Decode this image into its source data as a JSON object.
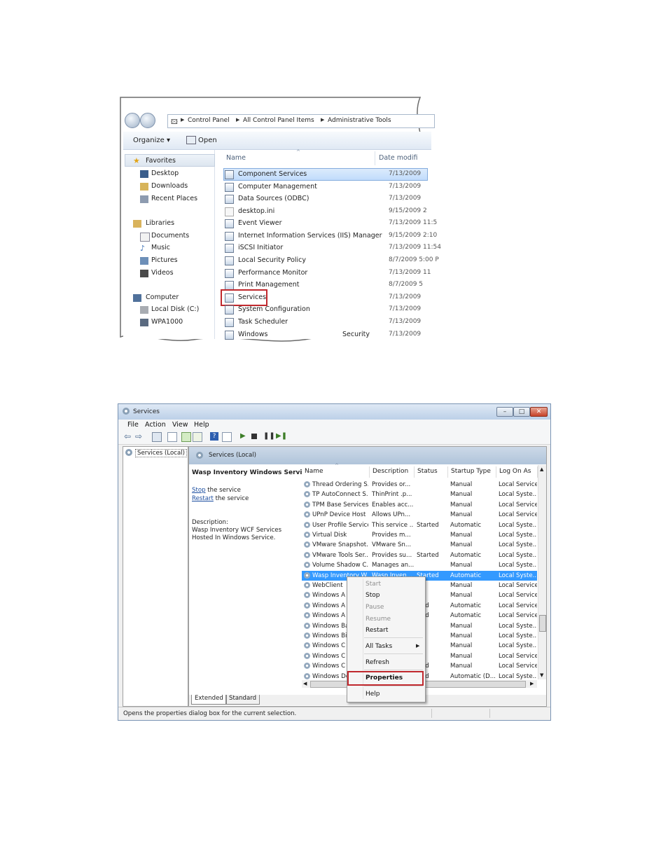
{
  "explorer": {
    "breadcrumb": [
      "Control Panel",
      "All Control Panel Items",
      "Administrative Tools"
    ],
    "toolbar": {
      "organize": "Organize",
      "open": "Open"
    },
    "nav": {
      "favorites": {
        "label": "Favorites",
        "items": [
          "Desktop",
          "Downloads",
          "Recent Places"
        ]
      },
      "libraries": {
        "label": "Libraries",
        "items": [
          "Documents",
          "Music",
          "Pictures",
          "Videos"
        ]
      },
      "computer": {
        "label": "Computer",
        "items": [
          "Local Disk (C:)",
          "WPA1000"
        ]
      }
    },
    "columns": {
      "name": "Name",
      "date": "Date modifi"
    },
    "files": [
      {
        "name": "Component Services",
        "date": "7/13/2009"
      },
      {
        "name": "Computer Management",
        "date": "7/13/2009"
      },
      {
        "name": "Data Sources (ODBC)",
        "date": "7/13/2009"
      },
      {
        "name": "desktop.ini",
        "date": "9/15/2009 2"
      },
      {
        "name": "Event Viewer",
        "date": "7/13/2009 11:5"
      },
      {
        "name": "Internet Information Services (IIS) Manager",
        "date": "9/15/2009 2:10"
      },
      {
        "name": "iSCSI Initiator",
        "date": "7/13/2009 11:54"
      },
      {
        "name": "Local Security Policy",
        "date": "8/7/2009 5:00 P"
      },
      {
        "name": "Performance Monitor",
        "date": "7/13/2009 11"
      },
      {
        "name": "Print Management",
        "date": "8/7/2009 5"
      },
      {
        "name": "Services",
        "date": "7/13/2009"
      },
      {
        "name": "System Configuration",
        "date": "7/13/2009"
      },
      {
        "name": "Task Scheduler",
        "date": "7/13/2009"
      },
      {
        "name": "Windows",
        "name_tail": "Security",
        "date": "7/13/2009"
      }
    ]
  },
  "services": {
    "title": "Services",
    "menu": [
      "File",
      "Action",
      "View",
      "Help"
    ],
    "tree_item": "Services (Local)",
    "content_header": "Services (Local)",
    "detail": {
      "service_name": "Wasp Inventory Windows Service",
      "stop_link": "Stop",
      "stop_rest": " the service",
      "restart_link": "Restart",
      "restart_rest": " the service",
      "desc_label": "Description:",
      "desc_text": "Wasp Inventory WCF Services Hosted In Windows Service."
    },
    "columns": [
      "Name",
      "Description",
      "Status",
      "Startup Type",
      "Log On As"
    ],
    "rows": [
      {
        "name": "Thread Ordering S...",
        "desc": "Provides or...",
        "status": "",
        "startup": "Manual",
        "logon": "Local Service"
      },
      {
        "name": "TP AutoConnect S...",
        "desc": "ThinPrint .p...",
        "status": "",
        "startup": "Manual",
        "logon": "Local Syste..."
      },
      {
        "name": "TPM Base Services",
        "desc": "Enables acc...",
        "status": "",
        "startup": "Manual",
        "logon": "Local Service"
      },
      {
        "name": "UPnP Device Host",
        "desc": "Allows UPn...",
        "status": "",
        "startup": "Manual",
        "logon": "Local Service"
      },
      {
        "name": "User Profile Service",
        "desc": "This service ...",
        "status": "Started",
        "startup": "Automatic",
        "logon": "Local Syste..."
      },
      {
        "name": "Virtual Disk",
        "desc": "Provides m...",
        "status": "",
        "startup": "Manual",
        "logon": "Local Syste..."
      },
      {
        "name": "VMware Snapshot...",
        "desc": "VMware Sn...",
        "status": "",
        "startup": "Manual",
        "logon": "Local Syste..."
      },
      {
        "name": "VMware Tools Ser...",
        "desc": "Provides su...",
        "status": "Started",
        "startup": "Automatic",
        "logon": "Local Syste..."
      },
      {
        "name": "Volume Shadow C...",
        "desc": "Manages an...",
        "status": "",
        "startup": "Manual",
        "logon": "Local Syste..."
      },
      {
        "name": "Wasp Inventory W...",
        "desc": "Wasp Inven...",
        "status": "Started",
        "startup": "Automatic",
        "logon": "Local Syste..."
      },
      {
        "name": "WebClient",
        "desc": "",
        "status": "",
        "startup": "Manual",
        "logon": "Local Service"
      },
      {
        "name": "Windows A",
        "desc": "",
        "status": "",
        "startup": "Manual",
        "logon": "Local Service"
      },
      {
        "name": "Windows A",
        "desc": "",
        "status": "rted",
        "startup": "Automatic",
        "logon": "Local Service"
      },
      {
        "name": "Windows A",
        "desc": "",
        "status": "rted",
        "startup": "Automatic",
        "logon": "Local Service"
      },
      {
        "name": "Windows Ba",
        "desc": "",
        "status": "",
        "startup": "Manual",
        "logon": "Local Syste..."
      },
      {
        "name": "Windows Bi",
        "desc": "",
        "status": "",
        "startup": "Manual",
        "logon": "Local Syste..."
      },
      {
        "name": "Windows C",
        "desc": "",
        "status": "",
        "startup": "Manual",
        "logon": "Local Syste..."
      },
      {
        "name": "Windows C",
        "desc": "",
        "status": "",
        "startup": "Manual",
        "logon": "Local Service"
      },
      {
        "name": "Windows C",
        "desc": "",
        "status": "rted",
        "startup": "Manual",
        "logon": "Local Service"
      },
      {
        "name": "Windows De",
        "desc": "",
        "status": "rted",
        "startup": "Automatic (D...",
        "logon": "Local Syste..."
      }
    ],
    "selected_row": 9,
    "context_menu": {
      "start": "Start",
      "stop": "Stop",
      "pause": "Pause",
      "resume": "Resume",
      "restart": "Restart",
      "all_tasks": "All Tasks",
      "refresh": "Refresh",
      "properties": "Properties",
      "help": "Help"
    },
    "tabs": [
      "Extended",
      "Standard"
    ],
    "status_text": "Opens the properties dialog box for the current selection."
  },
  "colors": {
    "highlight": "#c0282d",
    "selection": "#3399ff"
  }
}
